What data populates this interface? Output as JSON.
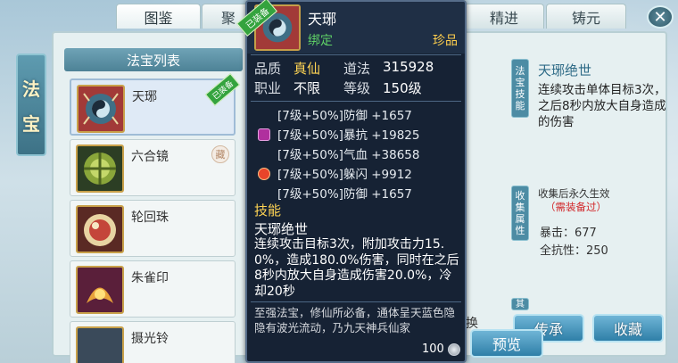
{
  "side_tab": {
    "chars": [
      "法",
      "宝"
    ]
  },
  "tabs": [
    "图鉴",
    "聚",
    "精进",
    "铸元"
  ],
  "close_label": "✕",
  "list": {
    "header": "法宝列表",
    "items": [
      {
        "name": "天琊",
        "tag": "已装备"
      },
      {
        "name": "六合镜",
        "mark": "藏"
      },
      {
        "name": "轮回珠"
      },
      {
        "name": "朱雀印"
      },
      {
        "name": "摄光铃"
      }
    ]
  },
  "right_panel": {
    "skill_label": "法宝技能",
    "skill_title": "天琊绝世",
    "skill_desc": "连续攻击单体目标3次，之后8秒内放大自身造成的伤害",
    "collect_label": "收集属性",
    "collect_text": "收集后永久生效",
    "need_text": "（需装备过）",
    "stats": [
      "暴击：677",
      "全抗性：250"
    ],
    "extra_label": "其",
    "huan": "换",
    "buttons": {
      "inherit": "传承",
      "collect": "收藏",
      "preview": "预览"
    }
  },
  "tooltip": {
    "name": "天琊",
    "badge": "已装备",
    "bind": "绑定",
    "rarity": "珍品",
    "quality_label": "品质",
    "quality_value": "真仙",
    "daofa_label": "道法",
    "daofa_value": "315928",
    "job_label": "职业",
    "job_value": "不限",
    "level_label": "等级",
    "level_value": "150级",
    "attributes": [
      "[7级+50%]防御 +1657",
      "[7级+50%]暴抗 +19825",
      "[7级+50%]气血 +38658",
      "[7级+50%]躲闪 +9912",
      "[7级+50%]防御 +1657"
    ],
    "skill_header": "技能",
    "skill_name": "天琊绝世",
    "skill_desc": "连续攻击目标3次，附加攻击力15.0%，造成180.0%伤害，同时在之后8秒内放大自身造成伤害20.0%，冷却20秒",
    "flavor": "至强法宝，修仙所必备，通体呈天蓝色隐隐有波光流动，乃九天神兵仙家",
    "price": "100"
  },
  "colors": {
    "gold": "#ffd454",
    "green": "#5fd066",
    "red": "#d2282b",
    "panel_dark": "#162234"
  }
}
